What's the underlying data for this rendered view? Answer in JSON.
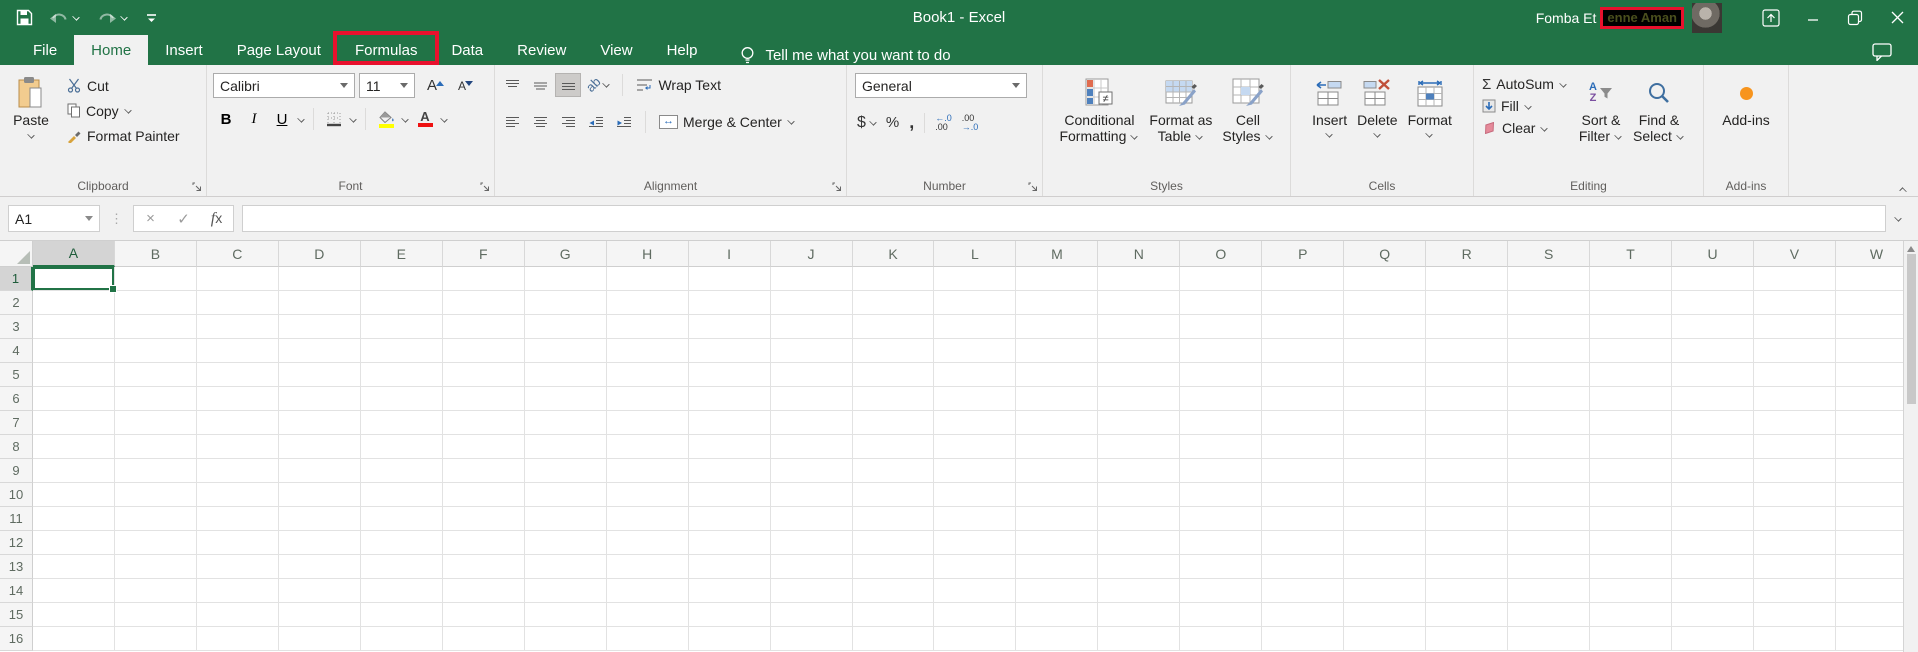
{
  "colors": {
    "excel_green": "#217346",
    "ribbon_bg": "#f1f1f1",
    "annotation_red": "#e8112d",
    "fill_yellow": "#ffff00",
    "font_color_red": "#ee1111",
    "addins_orange": "#f7941d",
    "accent_blue": "#2b6cb8",
    "sort_purple": "#7b4fa0",
    "selection_green": "#217346"
  },
  "titlebar": {
    "title": "Book1 - Excel",
    "user_name_visible": "Fomba Et",
    "user_name_redacted": "enne Aman"
  },
  "tabs": {
    "items": [
      {
        "label": "File"
      },
      {
        "label": "Home"
      },
      {
        "label": "Insert"
      },
      {
        "label": "Page Layout"
      },
      {
        "label": "Formulas"
      },
      {
        "label": "Data"
      },
      {
        "label": "Review"
      },
      {
        "label": "View"
      },
      {
        "label": "Help"
      }
    ],
    "active_tab": "Home",
    "annotated_tab": "Formulas",
    "tell_me": "Tell me what you want to do"
  },
  "ribbon": {
    "clipboard": {
      "group_label": "Clipboard",
      "paste_label": "Paste",
      "cut_label": "Cut",
      "copy_label": "Copy",
      "format_painter_label": "Format Painter"
    },
    "font": {
      "group_label": "Font",
      "font_name": "Calibri",
      "font_size": "11",
      "bold_label": "B",
      "italic_label": "I",
      "underline_label": "U",
      "grow_font_label": "A",
      "shrink_font_label": "A"
    },
    "alignment": {
      "group_label": "Alignment",
      "orientation_label": "ab",
      "wrap_text_label": "Wrap Text",
      "merge_center_label": "Merge & Center",
      "merge_arrow": "↔"
    },
    "number": {
      "group_label": "Number",
      "format_value": "General",
      "currency_label": "$",
      "percent_label": "%",
      "comma_label": ",",
      "inc_dec_top": "←.0",
      "inc_dec_bottom": ".00",
      "dec_dec_top": ".00",
      "dec_dec_bottom": "→.0"
    },
    "styles": {
      "group_label": "Styles",
      "cond_format_line1": "Conditional",
      "cond_format_line2": "Formatting",
      "neq_badge": "≠",
      "format_table_line1": "Format as",
      "format_table_line2": "Table",
      "cell_styles_line1": "Cell",
      "cell_styles_line2": "Styles"
    },
    "cells": {
      "group_label": "Cells",
      "insert_label": "Insert",
      "delete_label": "Delete",
      "format_label": "Format"
    },
    "editing": {
      "group_label": "Editing",
      "autosum_sigma": "Σ",
      "autosum_label": "AutoSum",
      "fill_label": "Fill",
      "clear_label": "Clear",
      "sort_letter_a": "A",
      "sort_letter_z": "Z",
      "sort_line1": "Sort &",
      "sort_line2": "Filter",
      "find_line1": "Find &",
      "find_line2": "Select"
    },
    "addins": {
      "group_label": "Add-ins",
      "button_label": "Add-ins"
    }
  },
  "formula_bar": {
    "name_box_value": "A1",
    "cancel_glyph": "×",
    "enter_glyph": "✓",
    "fx_label": "x",
    "formula_value": ""
  },
  "grid": {
    "columns": [
      "A",
      "B",
      "C",
      "D",
      "E",
      "F",
      "G",
      "H",
      "I",
      "J",
      "K",
      "L",
      "M",
      "N",
      "O",
      "P",
      "Q",
      "R",
      "S",
      "T",
      "U",
      "V",
      "W"
    ],
    "rows": [
      "1",
      "2",
      "3",
      "4",
      "5",
      "6",
      "7",
      "8",
      "9",
      "10",
      "11",
      "12",
      "13",
      "14",
      "15",
      "16"
    ],
    "selected_cell": "A1",
    "selected_column": "A",
    "selected_row": "1"
  }
}
